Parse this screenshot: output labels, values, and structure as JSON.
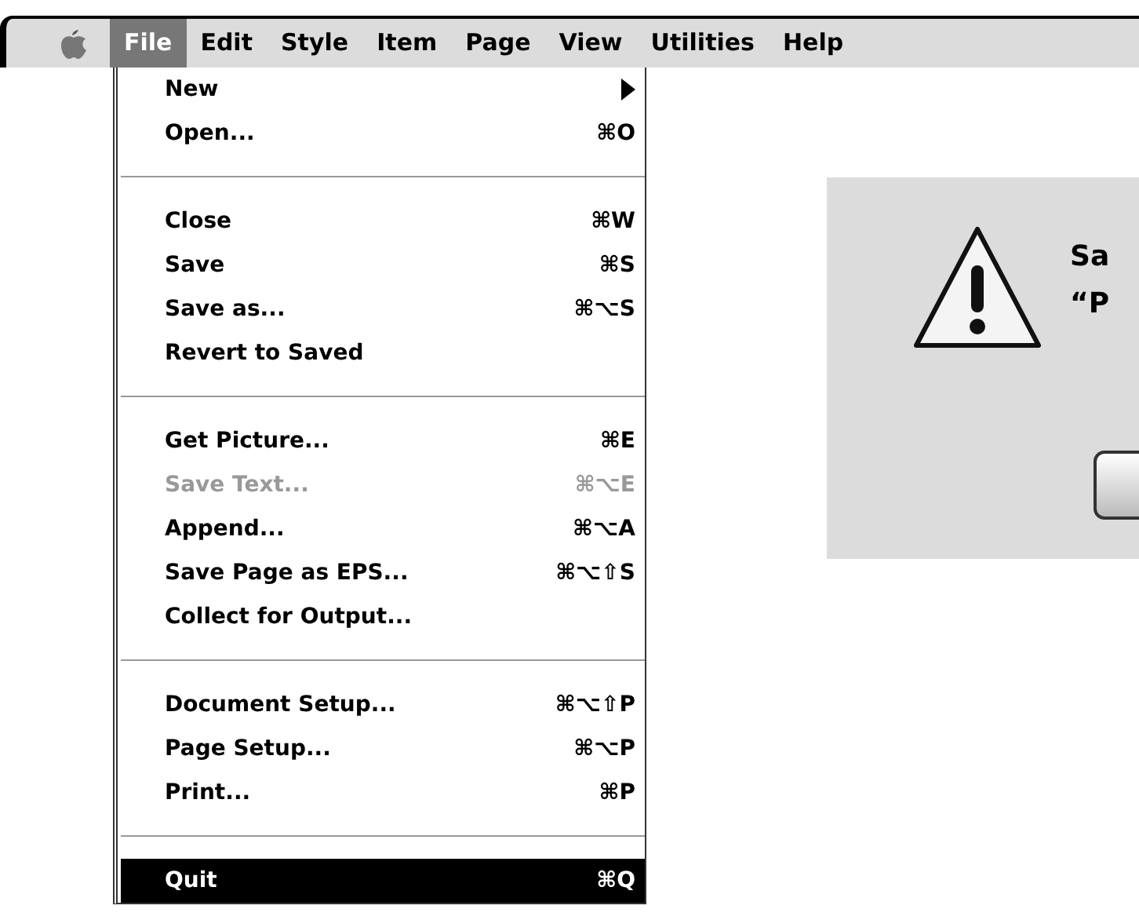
{
  "menu_bar": {
    "menus": [
      {
        "label": "File",
        "selected": true
      },
      {
        "label": "Edit",
        "selected": false
      },
      {
        "label": "Style",
        "selected": false
      },
      {
        "label": "Item",
        "selected": false
      },
      {
        "label": "Page",
        "selected": false
      },
      {
        "label": "View",
        "selected": false
      },
      {
        "label": "Utilities",
        "selected": false
      },
      {
        "label": "Help",
        "selected": false
      }
    ]
  },
  "file_menu": {
    "items": [
      {
        "kind": "item",
        "label": "New",
        "submenu": true,
        "disabled": false,
        "selected": false
      },
      {
        "kind": "item",
        "label": "Open...",
        "shortcut": "⌘O",
        "submenu": false,
        "disabled": false,
        "selected": false
      },
      {
        "kind": "separator"
      },
      {
        "kind": "item",
        "label": "Close",
        "shortcut": "⌘W",
        "submenu": false,
        "disabled": false,
        "selected": false
      },
      {
        "kind": "item",
        "label": "Save",
        "shortcut": "⌘S",
        "submenu": false,
        "disabled": false,
        "selected": false
      },
      {
        "kind": "item",
        "label": "Save as...",
        "shortcut": "⌘⌥S",
        "submenu": false,
        "disabled": false,
        "selected": false
      },
      {
        "kind": "item",
        "label": "Revert to Saved",
        "submenu": false,
        "disabled": false,
        "selected": false
      },
      {
        "kind": "separator"
      },
      {
        "kind": "item",
        "label": "Get Picture...",
        "shortcut": "⌘E",
        "submenu": false,
        "disabled": false,
        "selected": false
      },
      {
        "kind": "item",
        "label": "Save Text...",
        "shortcut": "⌘⌥E",
        "submenu": false,
        "disabled": true,
        "selected": false
      },
      {
        "kind": "item",
        "label": "Append...",
        "shortcut": "⌘⌥A",
        "submenu": false,
        "disabled": false,
        "selected": false
      },
      {
        "kind": "item",
        "label": "Save Page as EPS...",
        "shortcut": "⌘⌥⇧S",
        "submenu": false,
        "disabled": false,
        "selected": false
      },
      {
        "kind": "item",
        "label": "Collect for Output...",
        "submenu": false,
        "disabled": false,
        "selected": false
      },
      {
        "kind": "separator"
      },
      {
        "kind": "item",
        "label": "Document Setup...",
        "shortcut": "⌘⌥⇧P",
        "submenu": false,
        "disabled": false,
        "selected": false
      },
      {
        "kind": "item",
        "label": "Page Setup...",
        "shortcut": "⌘⌥P",
        "submenu": false,
        "disabled": false,
        "selected": false
      },
      {
        "kind": "item",
        "label": "Print...",
        "shortcut": "⌘P",
        "submenu": false,
        "disabled": false,
        "selected": false
      },
      {
        "kind": "separator"
      },
      {
        "kind": "item",
        "label": "Quit",
        "shortcut": "⌘Q",
        "submenu": false,
        "disabled": false,
        "selected": true
      }
    ]
  },
  "alert_dialog": {
    "message_lines": [
      "Sa",
      "“P"
    ]
  }
}
